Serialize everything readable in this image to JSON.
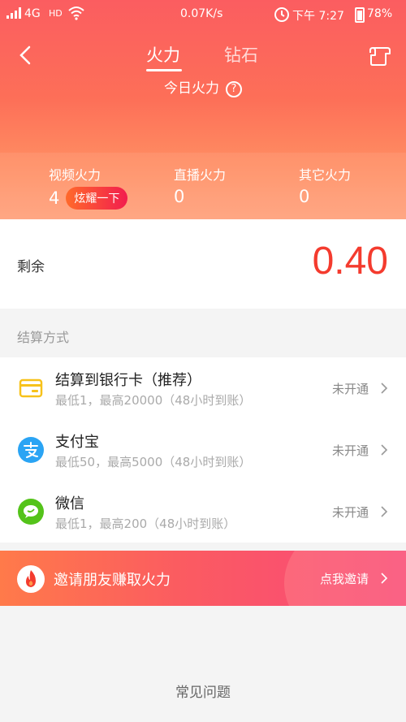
{
  "status": {
    "network": "4G",
    "hd": "HD",
    "speed": "0.07K/s",
    "time": "下午 7:27",
    "battery": "78%"
  },
  "nav": {
    "tabs": [
      {
        "label": "火力"
      },
      {
        "label": "钻石"
      }
    ],
    "active_tab": "火力"
  },
  "today": {
    "label": "今日火力",
    "help_icon": "?"
  },
  "stats": [
    {
      "label": "视频火力",
      "value": "4",
      "badge": "炫耀一下"
    },
    {
      "label": "直播火力",
      "value": "0"
    },
    {
      "label": "其它火力",
      "value": "0"
    }
  ],
  "remaining": {
    "label": "剩余",
    "value": "0.40"
  },
  "settlement": {
    "title": "结算方式",
    "methods": [
      {
        "title": "结算到银行卡（推荐）",
        "subtitle": "最低1，最高20000（48小时到账）",
        "status": "未开通",
        "icon": "bank-card-icon",
        "color": "#f7c21b"
      },
      {
        "title": "支付宝",
        "subtitle": "最低50，最高5000（48小时到账）",
        "status": "未开通",
        "icon": "alipay-icon",
        "color": "#2aa4f4"
      },
      {
        "title": "微信",
        "subtitle": "最低1，最高200（48小时到账）",
        "status": "未开通",
        "icon": "wechat-icon",
        "color": "#54c31a"
      }
    ]
  },
  "invite": {
    "text": "邀请朋友赚取火力",
    "action": "点我邀请",
    "icon": "fire-icon"
  },
  "faq": {
    "label": "常见问题"
  },
  "colors": {
    "accent": "#fb5d60",
    "value_red": "#f43b2e"
  }
}
